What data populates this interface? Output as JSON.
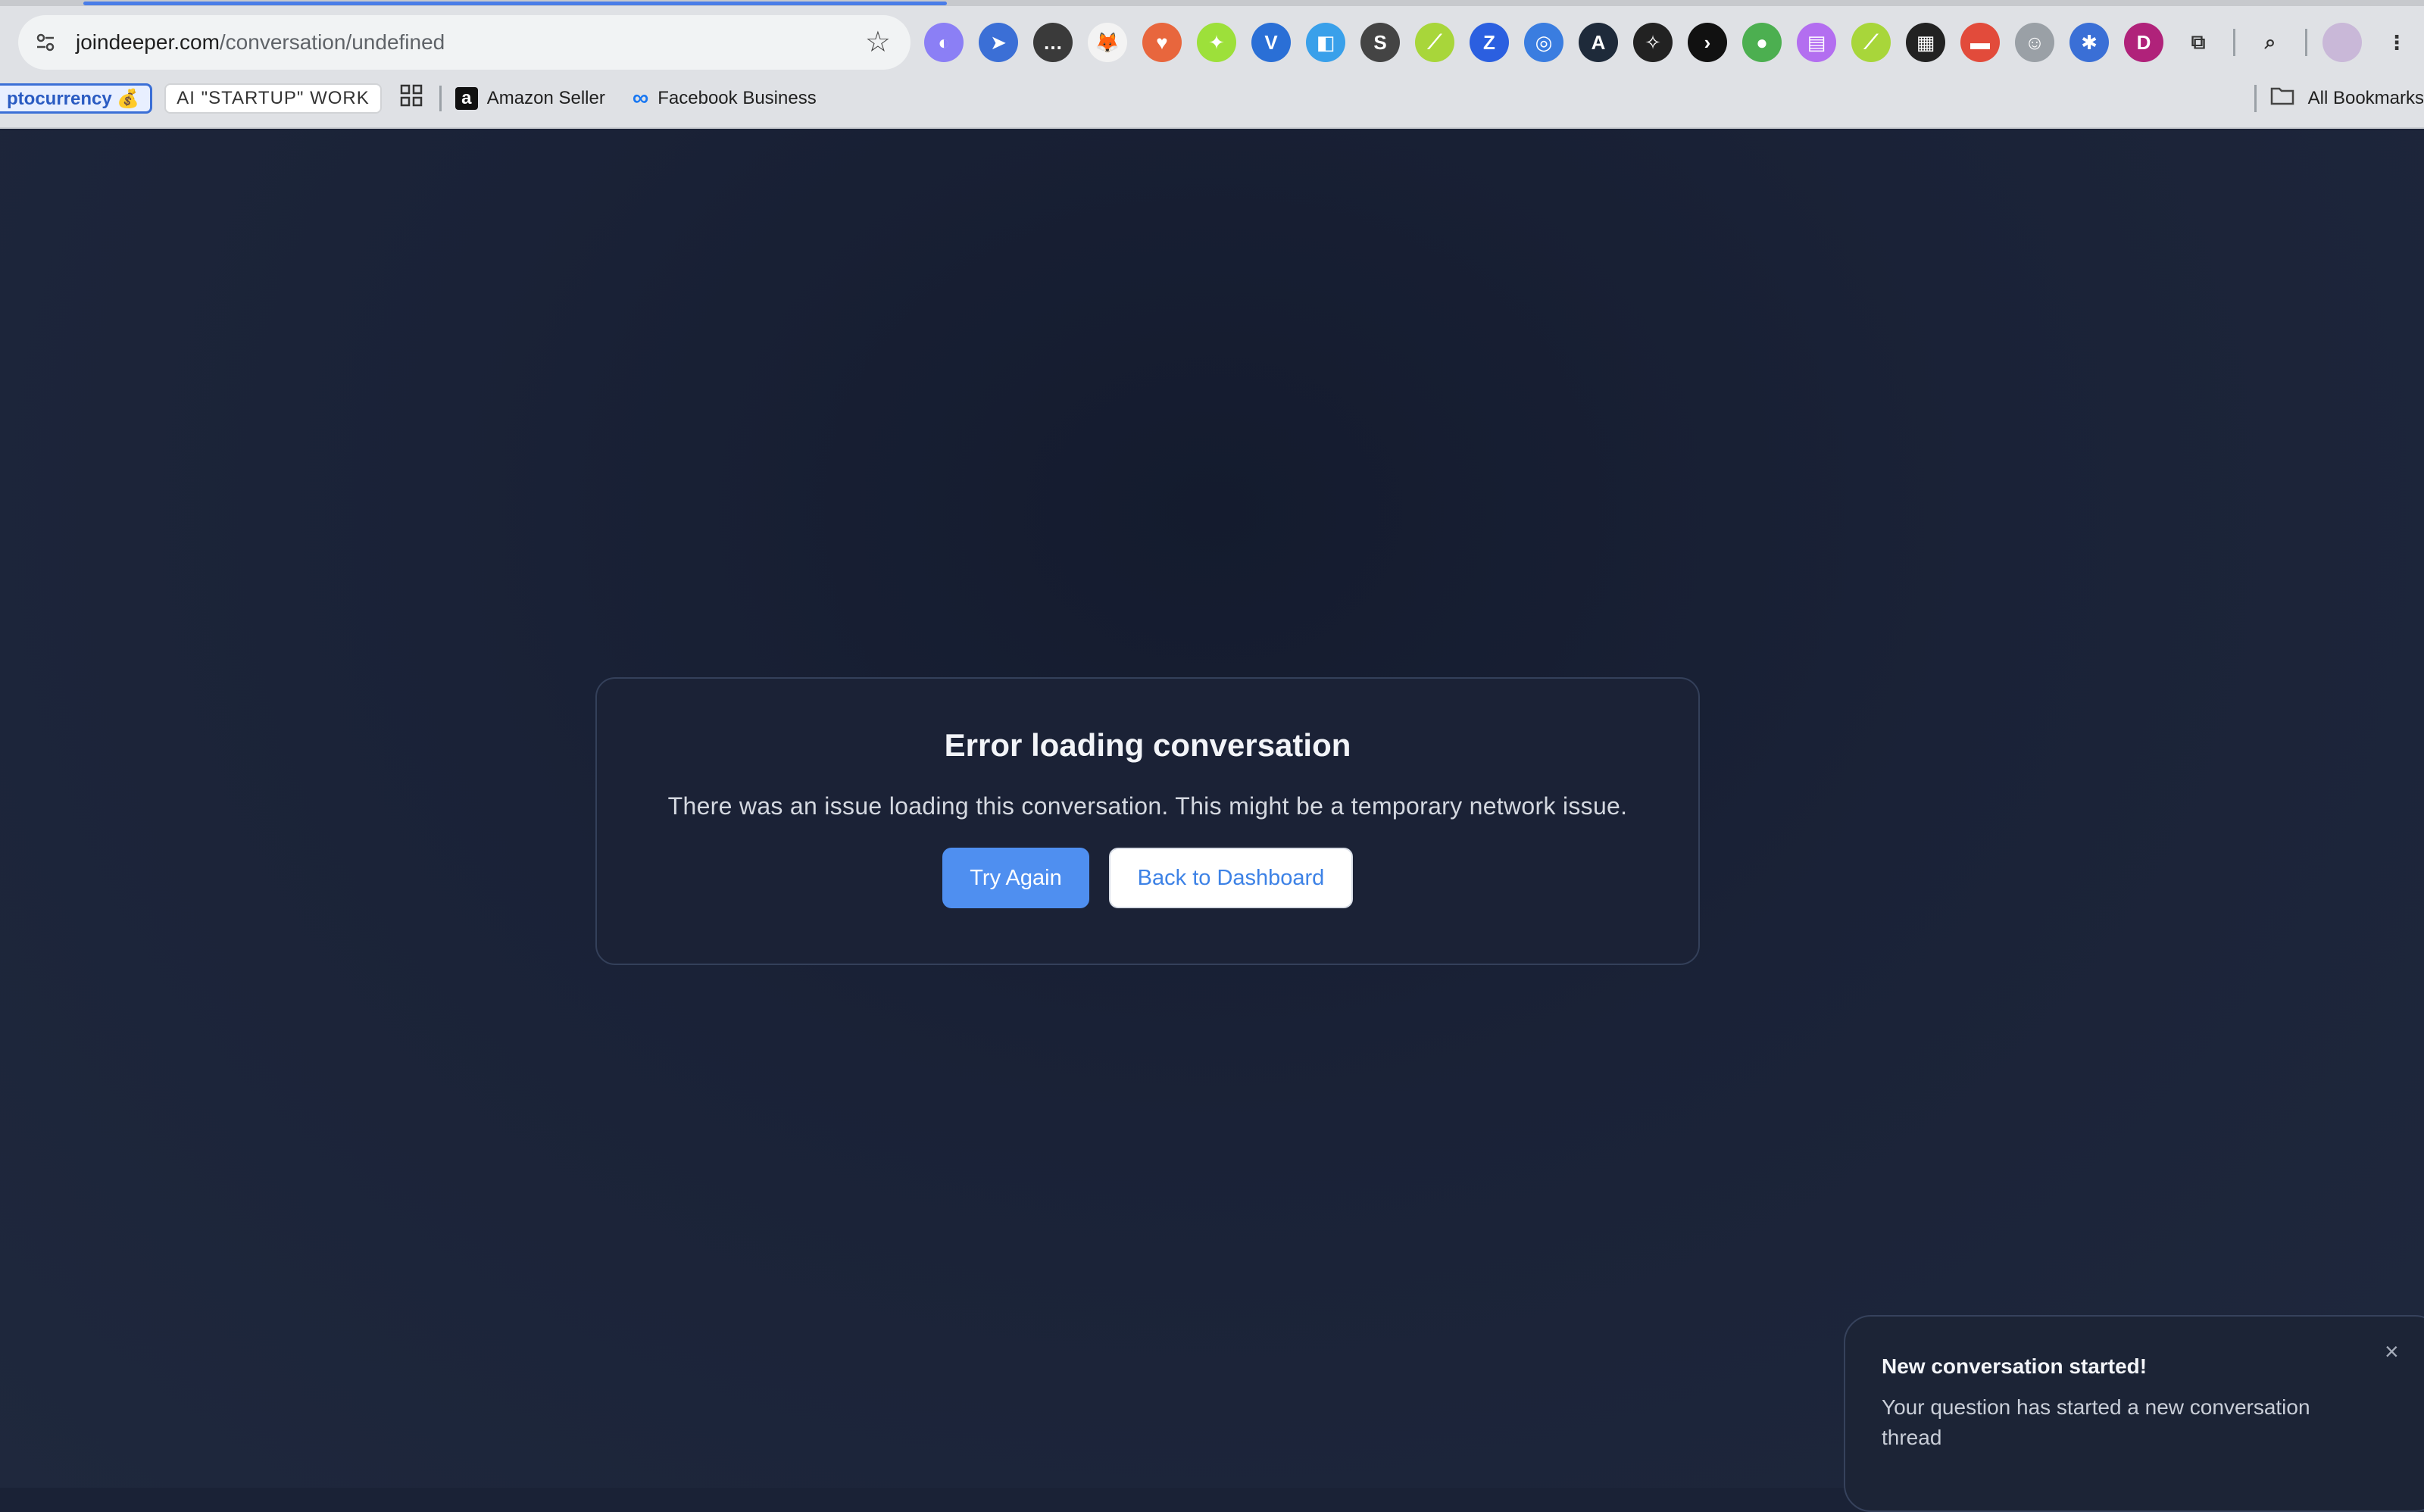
{
  "browser": {
    "url_domain": "joindeeper.com",
    "url_path": "/conversation/undefined",
    "bookmarks": {
      "crypto": "ptocurrency 💰",
      "startup": "AI \"STARTUP\" WORK",
      "amazon_logo": "a",
      "amazon": "Amazon Seller",
      "meta_logo": "∞",
      "facebook": "Facebook Business",
      "all": "All Bookmarks"
    },
    "extensions": [
      {
        "name": "ext-1-icon",
        "glyph": "◐",
        "color": "#8b7ff5"
      },
      {
        "name": "ext-2-icon",
        "glyph": "➤",
        "color": "#3b6fd6"
      },
      {
        "name": "ext-3-icon",
        "glyph": "…",
        "color": "#3a3a3a"
      },
      {
        "name": "metamask-icon",
        "glyph": "🦊",
        "color": "#f3f3f3"
      },
      {
        "name": "heart-icon",
        "glyph": "♥",
        "color": "#e8663d"
      },
      {
        "name": "ext-6-icon",
        "glyph": "✦",
        "color": "#9de03a"
      },
      {
        "name": "ext-7-icon",
        "glyph": "V",
        "color": "#2a6fd6"
      },
      {
        "name": "ext-8-icon",
        "glyph": "◧",
        "color": "#39a0ea"
      },
      {
        "name": "ext-9-icon",
        "glyph": "S",
        "color": "#444444"
      },
      {
        "name": "ext-10-icon",
        "glyph": "⟋",
        "color": "#a8d63a"
      },
      {
        "name": "ext-11-icon",
        "glyph": "Z",
        "color": "#2b5fe0"
      },
      {
        "name": "ext-12-icon",
        "glyph": "◎",
        "color": "#3a7de0"
      },
      {
        "name": "ext-13-icon",
        "glyph": "A",
        "color": "#1e2a3a"
      },
      {
        "name": "ext-14-icon",
        "glyph": "✧",
        "color": "#222222"
      },
      {
        "name": "ext-15-icon",
        "glyph": "›",
        "color": "#111111"
      },
      {
        "name": "ext-16-icon",
        "glyph": "●",
        "color": "#4caf50"
      },
      {
        "name": "ext-17-icon",
        "glyph": "▤",
        "color": "#b36ef0"
      },
      {
        "name": "ext-18-icon",
        "glyph": "⟋",
        "color": "#a8d63a"
      },
      {
        "name": "ext-19-icon",
        "glyph": "▦",
        "color": "#222222"
      },
      {
        "name": "ext-20-icon",
        "glyph": "▬",
        "color": "#e24b3b"
      },
      {
        "name": "ext-21-icon",
        "glyph": "☺",
        "color": "#9aa0a6"
      },
      {
        "name": "ext-22-icon",
        "glyph": "✱",
        "color": "#3a6fd6"
      },
      {
        "name": "ext-23-icon",
        "glyph": "D",
        "color": "#b0227a"
      },
      {
        "name": "puzzle-icon",
        "glyph": "⧉",
        "color": "#333333"
      }
    ],
    "search_tabs_glyph": "⌕",
    "menu_glyph": "⋮"
  },
  "error_card": {
    "title": "Error loading conversation",
    "message": "There was an issue loading this conversation. This might be a temporary network issue.",
    "try_again": "Try Again",
    "back": "Back to Dashboard"
  },
  "toast": {
    "title": "New conversation started!",
    "description": "Your question has started a new conversation thread",
    "close": "×"
  },
  "colors": {
    "page_bg": "#1a2236",
    "primary_button": "#4f8ff0",
    "secondary_button_text": "#3d82e6"
  }
}
